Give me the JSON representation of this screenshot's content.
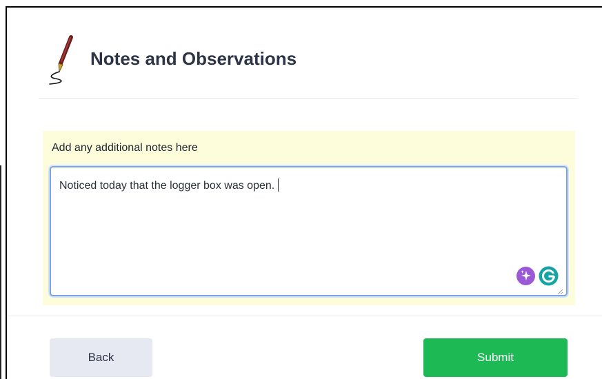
{
  "header": {
    "title": "Notes and Observations",
    "icon": "fountain-pen-icon"
  },
  "notes": {
    "label": "Add any additional notes here",
    "value": "Noticed today that the logger box was open.",
    "icons": [
      "ai-sparkle-icon",
      "grammarly-icon"
    ]
  },
  "actions": {
    "back_label": "Back",
    "submit_label": "Submit"
  },
  "colors": {
    "panel_background": "#fdfddc",
    "submit_green": "#1db954",
    "back_gray": "#e6e8f2",
    "focus_border": "#7aa3e6",
    "ai_purple": "#9b59d6",
    "grammarly_teal": "#15a3a3"
  }
}
